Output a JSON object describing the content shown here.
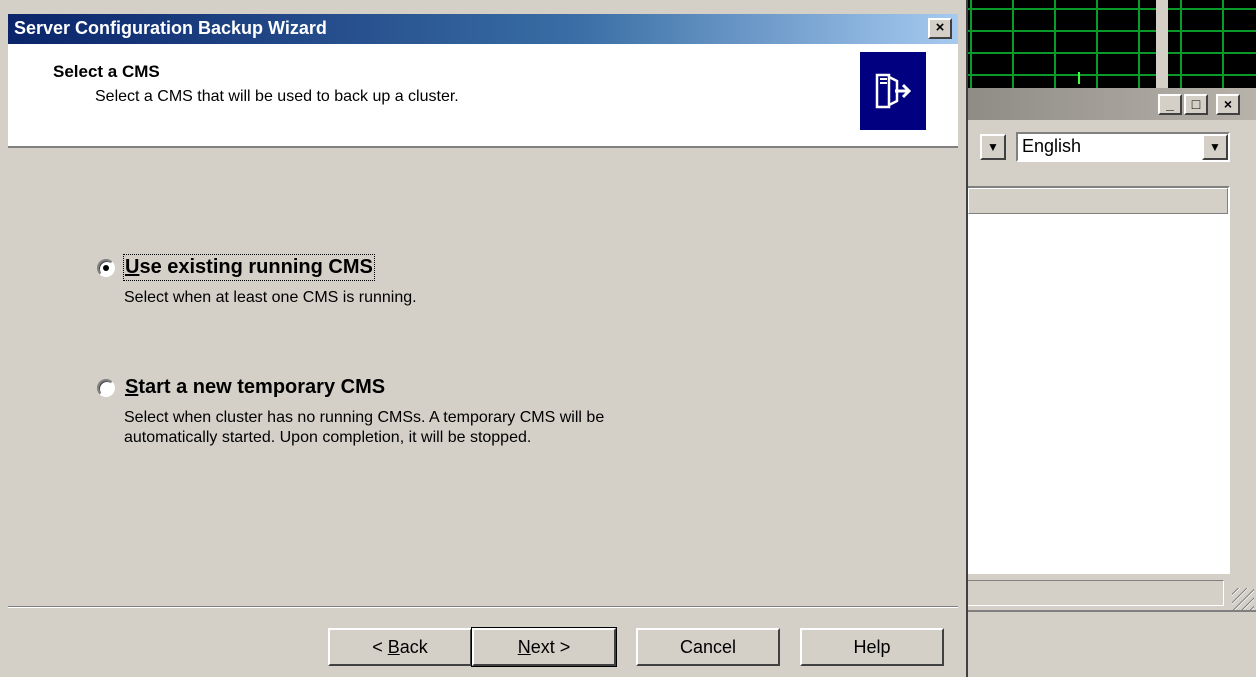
{
  "dialog": {
    "title": "Server Configuration Backup Wizard",
    "close_glyph": "×",
    "heading": "Select a CMS",
    "subheading": "Select a CMS that will be used to back up a cluster."
  },
  "options": [
    {
      "label_accel": "U",
      "label_rest": "se existing running CMS",
      "description": "Select when at least one CMS is running.",
      "selected": true
    },
    {
      "label_accel": "S",
      "label_rest": "tart a new temporary CMS",
      "description": "Select when cluster has no running CMSs.  A temporary CMS will be\nautomatically started.  Upon completion, it will be stopped.",
      "selected": false
    }
  ],
  "buttons": {
    "back_pre": "< ",
    "back_accel": "B",
    "back_rest": "ack",
    "next_accel": "N",
    "next_rest": "ext >",
    "cancel": "Cancel",
    "help": "Help"
  },
  "background_window": {
    "minimize_glyph": "_",
    "maximize_glyph": "□",
    "close_glyph": "×",
    "language_value": "English",
    "dropdown_glyph": "▼"
  },
  "colors": {
    "title_bar_start": "#0a246a",
    "title_bar_end": "#a6caf0",
    "wizard_icon_bg": "#000080",
    "face": "#d4d0c8"
  },
  "icons": {
    "wizard": "server-arrow-icon"
  }
}
